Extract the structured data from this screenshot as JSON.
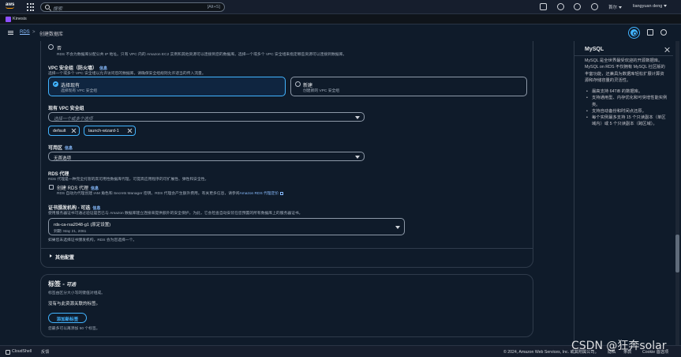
{
  "topbar": {
    "logo": "aws",
    "search_placeholder": "搜索",
    "search_shortcut": "[Alt+S]",
    "region": "首尔",
    "account": "liangyuan deng"
  },
  "servicebar": {
    "label": "Kinesis"
  },
  "breadcrumb": {
    "root": "RDS",
    "separator": ">",
    "current": "创建数据库"
  },
  "public_access": {
    "no_label": "否",
    "no_desc": "RDS 不会为数据库分配公共 IP 地址。只有 VPC 内的 Amazon EC2 实例和其他资源可以连接到您的数据库。选择一个或多个 VPC 安全组来指定哪些资源可以连接到数据库。"
  },
  "vpc_sg": {
    "label": "VPC 安全组（防火墙）",
    "info": "信息",
    "desc": "选择一个或多个 VPC 安全组以允许访问您的数据库。请确保安全组规则允许适当的传入流量。",
    "options": [
      {
        "title": "选择现有",
        "sub": "选择现有 VPC 安全组"
      },
      {
        "title": "新建",
        "sub": "创建新的 VPC 安全组"
      }
    ]
  },
  "existing_sg": {
    "label": "现有 VPC 安全组",
    "placeholder": "选择一个或多个选项",
    "tokens": [
      "default",
      "launch-wizard-1"
    ]
  },
  "az": {
    "label": "可用区",
    "info": "信息",
    "value": "无首选项"
  },
  "rds_proxy": {
    "label": "RDS 代理",
    "desc": "RDS 代理是一种完全托管的高可用性数据库代理，可提高应用程序的可扩展性、弹性和安全性。",
    "checkbox_label": "创建 RDS 代理",
    "info": "信息",
    "sub_desc": "RDS 自动为代理创建 IAM 角色和 Secrets Manager 密钥。RDS 代理会产生额外费用。有关更多信息，请参阅",
    "link": "Amazon RDS 代理定价"
  },
  "cert": {
    "label": "证书颁发机构 - 可选",
    "info": "信息",
    "desc": "使用服务器证书可通过验证是否已与 Amazon 数据库建立连接来提供额外的安全保护。为此，它会检查自动安装在您预置的所有数据库上的服务器证书。",
    "value": "rds-ca-rsa2048-g1 (原定设置)",
    "expiry": "到期: May 21, 2061",
    "note": "如果您未选择证书颁发机构，RDS 会为您选择一个。"
  },
  "additional": {
    "label": "其他配置"
  },
  "tags": {
    "title": "标签 -",
    "optional": "可选",
    "desc": "标签由区分大小写的键值对组成。",
    "empty": "没有与此资源关联的标签。",
    "add_button": "添加新标签",
    "limit": "您最多可以再添加 50 个标签。"
  },
  "help_panel": {
    "title": "MySQL",
    "intro": "MySQL 是全世界最受欢迎的开源数据库。MySQL on RDS 不仅拥有 MySQL 社区版的丰富功能，还兼具为数据库轻松扩展计算资源和存储容量的灵活性。",
    "bullets": [
      "最高支持 64TiB 的数据库。",
      "支持通用型、内存优化和可突增性能实例类。",
      "支持自动备份和时间点还原。",
      "每个实例最多支持 15 个只读副本（单区域内）或 5 个只读副本（跨区域）。"
    ]
  },
  "footer": {
    "cloudshell": "CloudShell",
    "feedback": "反馈",
    "copyright": "© 2024, Amazon Web Services, Inc. 或其附属公司。",
    "privacy": "隐私",
    "terms": "条款",
    "cookie": "Cookie 首选项"
  },
  "watermark": "CSDN @狂奔solar",
  "colors": {
    "accent": "#42b4ff",
    "link": "#89bdff",
    "background": "#0f1b2a",
    "brand": "#ff9900"
  }
}
